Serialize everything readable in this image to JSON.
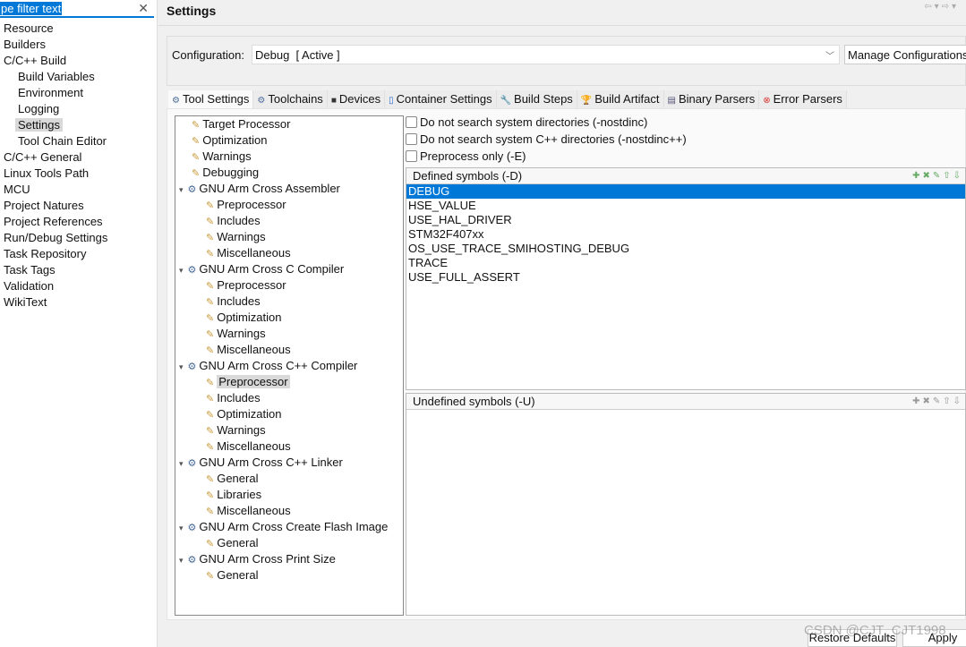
{
  "filter": {
    "value": "pe filter text"
  },
  "nav": [
    {
      "label": "Resource",
      "level": 0
    },
    {
      "label": "Builders",
      "level": 0
    },
    {
      "label": "C/C++ Build",
      "level": 0
    },
    {
      "label": "Build Variables",
      "level": 1
    },
    {
      "label": "Environment",
      "level": 1
    },
    {
      "label": "Logging",
      "level": 1
    },
    {
      "label": "Settings",
      "level": 1,
      "selected": true
    },
    {
      "label": "Tool Chain Editor",
      "level": 1
    },
    {
      "label": "C/C++ General",
      "level": 0
    },
    {
      "label": "Linux Tools Path",
      "level": 0
    },
    {
      "label": "MCU",
      "level": 0
    },
    {
      "label": "Project Natures",
      "level": 0
    },
    {
      "label": "Project References",
      "level": 0
    },
    {
      "label": "Run/Debug Settings",
      "level": 0
    },
    {
      "label": "Task Repository",
      "level": 0
    },
    {
      "label": "Task Tags",
      "level": 0
    },
    {
      "label": "Validation",
      "level": 0
    },
    {
      "label": "WikiText",
      "level": 0
    }
  ],
  "header": {
    "title": "Settings"
  },
  "config": {
    "label": "Configuration:",
    "value": "Debug  [ Active ]",
    "manage": "Manage Configurations..."
  },
  "tabs": [
    {
      "label": "Tool Settings",
      "icon": "gear-icon",
      "active": true
    },
    {
      "label": "Toolchains",
      "icon": "gear-icon"
    },
    {
      "label": "Devices",
      "icon": "chip-icon"
    },
    {
      "label": "Container Settings",
      "icon": "container-icon"
    },
    {
      "label": "Build Steps",
      "icon": "wrench-icon"
    },
    {
      "label": "Build Artifact",
      "icon": "trophy-icon"
    },
    {
      "label": "Binary Parsers",
      "icon": "binary-icon"
    },
    {
      "label": "Error Parsers",
      "icon": "error-icon"
    }
  ],
  "tree": [
    {
      "label": "Target Processor",
      "level": 0
    },
    {
      "label": "Optimization",
      "level": 0
    },
    {
      "label": "Warnings",
      "level": 0
    },
    {
      "label": "Debugging",
      "level": 0
    },
    {
      "label": "GNU Arm Cross Assembler",
      "level": 0,
      "tool": true
    },
    {
      "label": "Preprocessor",
      "level": 1
    },
    {
      "label": "Includes",
      "level": 1
    },
    {
      "label": "Warnings",
      "level": 1
    },
    {
      "label": "Miscellaneous",
      "level": 1
    },
    {
      "label": "GNU Arm Cross C Compiler",
      "level": 0,
      "tool": true
    },
    {
      "label": "Preprocessor",
      "level": 1
    },
    {
      "label": "Includes",
      "level": 1
    },
    {
      "label": "Optimization",
      "level": 1
    },
    {
      "label": "Warnings",
      "level": 1
    },
    {
      "label": "Miscellaneous",
      "level": 1
    },
    {
      "label": "GNU Arm Cross C++ Compiler",
      "level": 0,
      "tool": true
    },
    {
      "label": "Preprocessor",
      "level": 1,
      "selected": true
    },
    {
      "label": "Includes",
      "level": 1
    },
    {
      "label": "Optimization",
      "level": 1
    },
    {
      "label": "Warnings",
      "level": 1
    },
    {
      "label": "Miscellaneous",
      "level": 1
    },
    {
      "label": "GNU Arm Cross C++ Linker",
      "level": 0,
      "tool": true
    },
    {
      "label": "General",
      "level": 1
    },
    {
      "label": "Libraries",
      "level": 1
    },
    {
      "label": "Miscellaneous",
      "level": 1
    },
    {
      "label": "GNU Arm Cross Create Flash Image",
      "level": 0,
      "tool": true
    },
    {
      "label": "General",
      "level": 1
    },
    {
      "label": "GNU Arm Cross Print Size",
      "level": 0,
      "tool": true
    },
    {
      "label": "General",
      "level": 1
    }
  ],
  "options": [
    {
      "label": "Do not search system directories (-nostdinc)",
      "checked": false
    },
    {
      "label": "Do not search system C++ directories (-nostdinc++)",
      "checked": false
    },
    {
      "label": "Preprocess only (-E)",
      "checked": false
    }
  ],
  "defined": {
    "title": "Defined symbols (-D)",
    "items": [
      "DEBUG",
      "HSE_VALUE",
      "USE_HAL_DRIVER",
      "STM32F407xx",
      "OS_USE_TRACE_SMIHOSTING_DEBUG",
      "TRACE",
      "USE_FULL_ASSERT"
    ],
    "selected": 0
  },
  "undefined": {
    "title": "Undefined symbols (-U)",
    "items": []
  },
  "buttons": {
    "restore": "Restore Defaults",
    "apply": "Apply"
  },
  "watermark": "CSDN @CJT_CJT1998",
  "colors": {
    "selection": "#0078d7"
  }
}
